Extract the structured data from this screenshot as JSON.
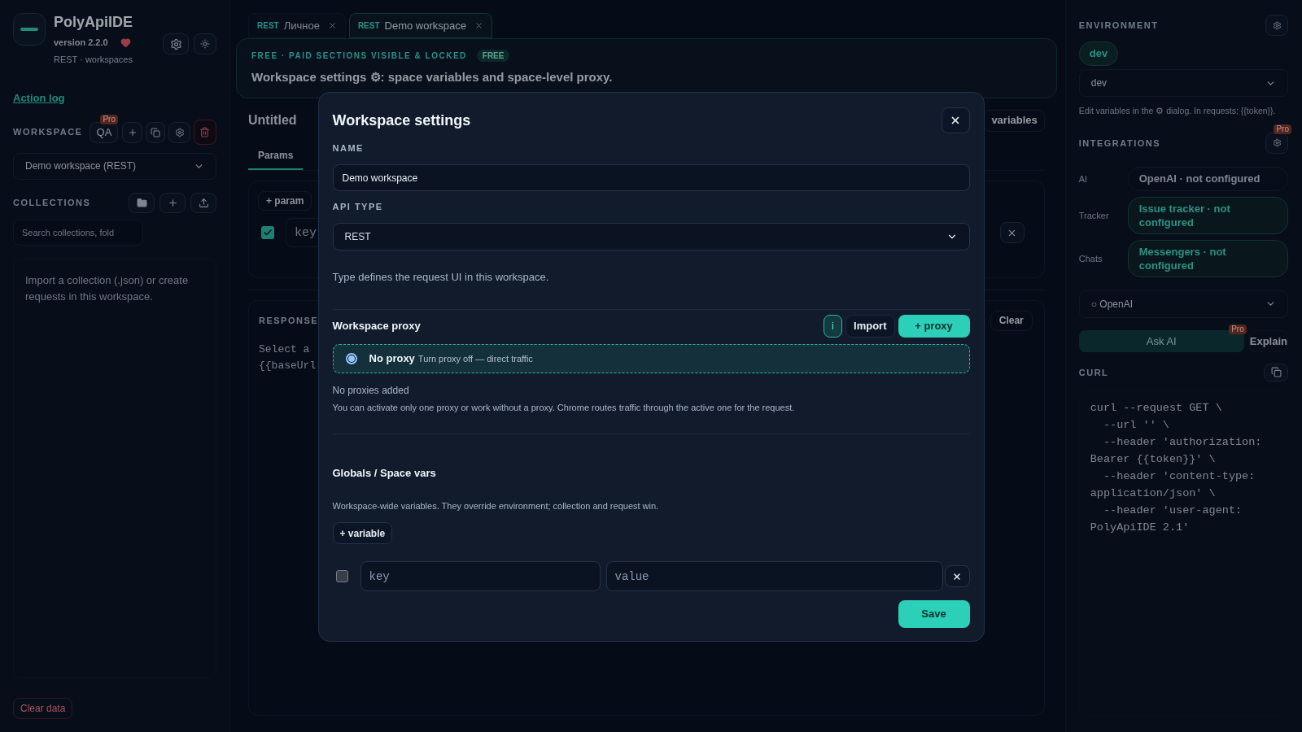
{
  "sidebar": {
    "app_name": "PolyApiIDE",
    "version": "version 2.2.0",
    "subtitle": "REST · workspaces",
    "action_log": "Action log",
    "workspace": {
      "label": "WORKSPACE",
      "qa_button": "QA",
      "qa_badge": "Pro",
      "select_value": "Demo workspace (REST)"
    },
    "collections": {
      "label": "COLLECTIONS",
      "search_placeholder": "Search collections, fold",
      "empty_text": "Import a collection (.json) or create requests in this workspace."
    },
    "clear_data": "Clear data"
  },
  "tabs": [
    {
      "type": "REST",
      "label": "Личное",
      "selected": false
    },
    {
      "type": "REST",
      "label": "Demo workspace",
      "selected": true
    }
  ],
  "banner": {
    "caption": "FREE · PAID SECTIONS VISIBLE & LOCKED",
    "badge": "FREE",
    "text": "Workspace settings ⚙: space variables and space-level proxy."
  },
  "request": {
    "title": "Untitled",
    "variables_button": "variables",
    "subtabs": [
      {
        "label": "Params",
        "selected": true
      }
    ],
    "add_param": "+ param",
    "param_row": {
      "checked": true,
      "key_placeholder": "key"
    }
  },
  "response": {
    "label": "RESPONSE",
    "clear": "Clear",
    "lines": [
      "Select a",
      "{{baseUrl"
    ]
  },
  "right_panel": {
    "environment": {
      "label": "ENVIRONMENT",
      "chip": "dev",
      "select_value": "dev",
      "hint": "Edit variables in the ⚙ dialog. In requests: {{token}}."
    },
    "integrations": {
      "label": "INTEGRATIONS",
      "badge": "Pro",
      "rows": [
        {
          "label": "AI",
          "value": "OpenAI · not configured",
          "active": false
        },
        {
          "label": "Tracker",
          "value": "Issue tracker · not configured",
          "active": true
        },
        {
          "label": "Chats",
          "value": "Messengers · not configured",
          "active": true
        }
      ]
    },
    "ai_select": "○ OpenAI",
    "ask_ai": "Ask AI",
    "ask_badge": "Pro",
    "explain": "Explain",
    "curl": {
      "label": "CURL",
      "lines": [
        "curl --request GET \\",
        "  --url '' \\",
        "  --header 'authorization:",
        "Bearer {{token}}' \\",
        "  --header 'content-type:",
        "application/json' \\",
        "  --header 'user-agent:",
        "PolyApiIDE 2.1'"
      ]
    }
  },
  "modal": {
    "title": "Workspace settings",
    "name_label": "NAME",
    "name_value": "Demo workspace",
    "api_type_label": "API TYPE",
    "api_type_value": "REST",
    "api_type_hint": "Type defines the request UI in this workspace.",
    "proxy": {
      "title": "Workspace proxy",
      "info": "i",
      "import": "Import",
      "add": "+ proxy",
      "options": [
        {
          "label": "No proxy",
          "description": "Turn proxy off — direct traffic",
          "selected": true
        }
      ],
      "empty": "No proxies added",
      "note": "You can activate only one proxy or work without a proxy. Chrome routes traffic through the active one for the request."
    },
    "globals": {
      "title": "Globals / Space vars",
      "description": "Workspace-wide variables. They override environment; collection and request win.",
      "add": "+ variable",
      "rows": [
        {
          "checked": false,
          "key_placeholder": "key",
          "value_placeholder": "value"
        }
      ]
    },
    "save": "Save"
  }
}
